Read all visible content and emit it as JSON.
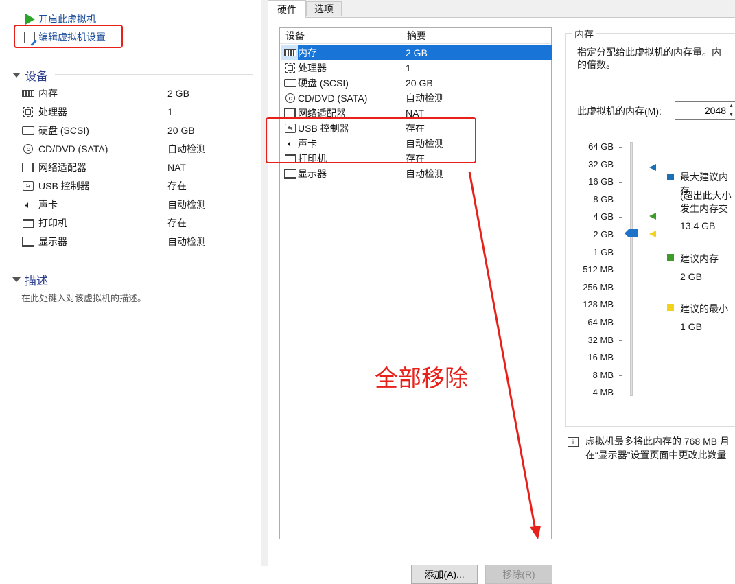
{
  "left_panel": {
    "actions": [
      {
        "label": "开启此虚拟机"
      },
      {
        "label": "编辑虚拟机设置"
      }
    ],
    "devices_section": {
      "title": "设备",
      "items": [
        {
          "name": "内存",
          "value": "2 GB",
          "icon": "memory-icon"
        },
        {
          "name": "处理器",
          "value": "1",
          "icon": "cpu-icon"
        },
        {
          "name": "硬盘 (SCSI)",
          "value": "20 GB",
          "icon": "hdd-icon"
        },
        {
          "name": "CD/DVD (SATA)",
          "value": "自动检测",
          "icon": "cd-icon"
        },
        {
          "name": "网络适配器",
          "value": "NAT",
          "icon": "network-icon"
        },
        {
          "name": "USB 控制器",
          "value": "存在",
          "icon": "usb-icon"
        },
        {
          "name": "声卡",
          "value": "自动检测",
          "icon": "sound-icon"
        },
        {
          "name": "打印机",
          "value": "存在",
          "icon": "printer-icon"
        },
        {
          "name": "显示器",
          "value": "自动检测",
          "icon": "monitor-icon"
        }
      ]
    },
    "description_section": {
      "title": "描述",
      "placeholder": "在此处键入对该虚拟机的描述。"
    }
  },
  "dialog": {
    "tabs": [
      {
        "label": "硬件",
        "active": true
      },
      {
        "label": "选项",
        "active": false
      }
    ],
    "device_list": {
      "columns": [
        "设备",
        "摘要"
      ],
      "rows": [
        {
          "name": "内存",
          "value": "2 GB",
          "selected": true
        },
        {
          "name": "处理器",
          "value": "1"
        },
        {
          "name": "硬盘 (SCSI)",
          "value": "20 GB"
        },
        {
          "name": "CD/DVD (SATA)",
          "value": "自动检测"
        },
        {
          "name": "网络适配器",
          "value": "NAT"
        },
        {
          "name": "USB 控制器",
          "value": "存在"
        },
        {
          "name": "声卡",
          "value": "自动检测"
        },
        {
          "name": "打印机",
          "value": "存在"
        },
        {
          "name": "显示器",
          "value": "自动检测"
        }
      ]
    },
    "buttons": {
      "add": "添加(A)...",
      "remove": "移除(R)"
    },
    "memory": {
      "group_title": "内存",
      "description_line1": "指定分配给此虚拟机的内存量。内",
      "description_line2": "的倍数。",
      "field_label": "此虚拟机的内存(M):",
      "field_value": "2048",
      "scale": [
        "64 GB",
        "32 GB",
        "16 GB",
        "8 GB",
        "4 GB",
        "2 GB",
        "1 GB",
        "512 MB",
        "256 MB",
        "128 MB",
        "64 MB",
        "32 MB",
        "16 MB",
        "8 MB",
        "4 MB"
      ],
      "legend": [
        {
          "title": "最大建议内存",
          "note_line1": "(超出此大小",
          "note_line2": "发生内存交",
          "value": "13.4 GB",
          "color": "#1a6fb5"
        },
        {
          "title": "建议内存",
          "value": "2 GB",
          "color": "#3f9a2c"
        },
        {
          "title": "建议的最小",
          "value": "1 GB",
          "color": "#f2d21b"
        }
      ],
      "info_line1": "虚拟机最多将此内存的 768 MB 月",
      "info_line2": "在“显示器”设置页面中更改此数量"
    }
  },
  "annotation": {
    "text": "全部移除",
    "color": "#e8201a"
  }
}
